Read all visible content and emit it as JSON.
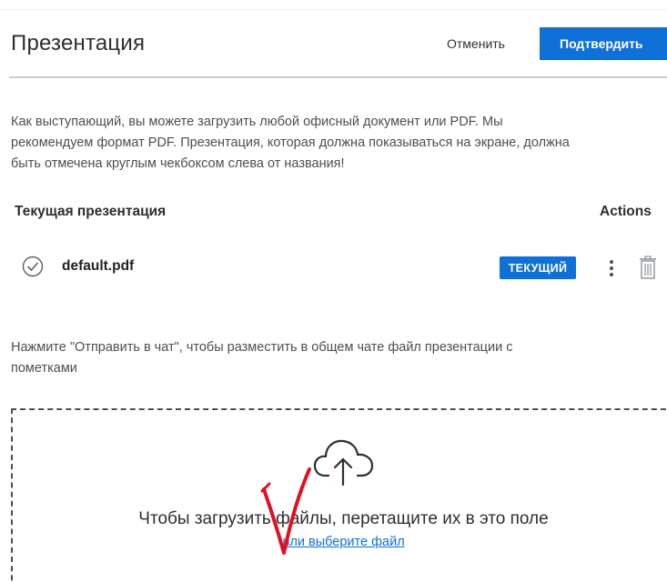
{
  "header": {
    "title": "Презентация",
    "cancel_label": "Отменить",
    "confirm_label": "Подтвердить"
  },
  "intro_lines": [
    "Как выступающий, вы можете загрузить любой офисный документ или PDF. Мы",
    "рекомендуем формат PDF. Презентация, которая должна показываться на экране, должна",
    "быть отмечена круглым чекбоксом слева от названия!"
  ],
  "table": {
    "col_current": "Текущая презентация",
    "col_actions": "Actions",
    "rows": [
      {
        "name": "default.pdf",
        "badge": "ТЕКУЩИЙ",
        "is_current": true
      }
    ]
  },
  "hint_lines": [
    "Нажмите \"Отправить в чат\", чтобы разместить в общем чате файл презентации с",
    "пометками"
  ],
  "dropzone": {
    "text": "Чтобы загрузить файлы, перетащите их в это поле",
    "link": "или выберите файл"
  },
  "icons": {
    "current": "check-circle-icon",
    "more": "more-vertical-icon",
    "delete": "trash-icon",
    "upload": "cloud-upload-icon"
  },
  "colors": {
    "accent": "#0f70d7",
    "annotation": "#e01020"
  }
}
